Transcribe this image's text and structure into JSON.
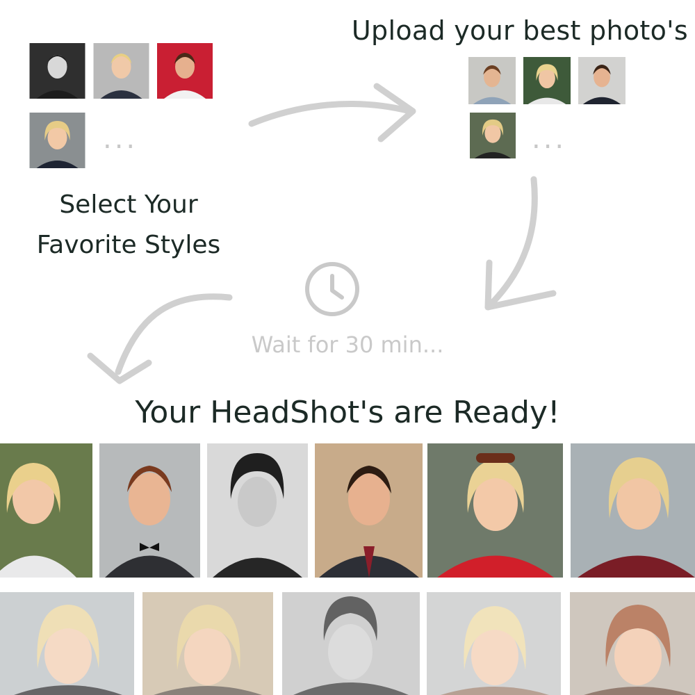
{
  "headings": {
    "upload": "Upload your best photo's",
    "select": [
      "Select Your",
      "Favorite Styles"
    ],
    "wait": "Wait for 30 min...",
    "ready": "Your HeadShot's are Ready!"
  },
  "ellipsis": "...",
  "icons": {
    "clock": "clock-icon",
    "arrow": "curved-arrow-icon"
  },
  "colors": {
    "text": "#1c2a26",
    "muted": "#c9c9c9",
    "arrow": "#d0d0d0"
  }
}
